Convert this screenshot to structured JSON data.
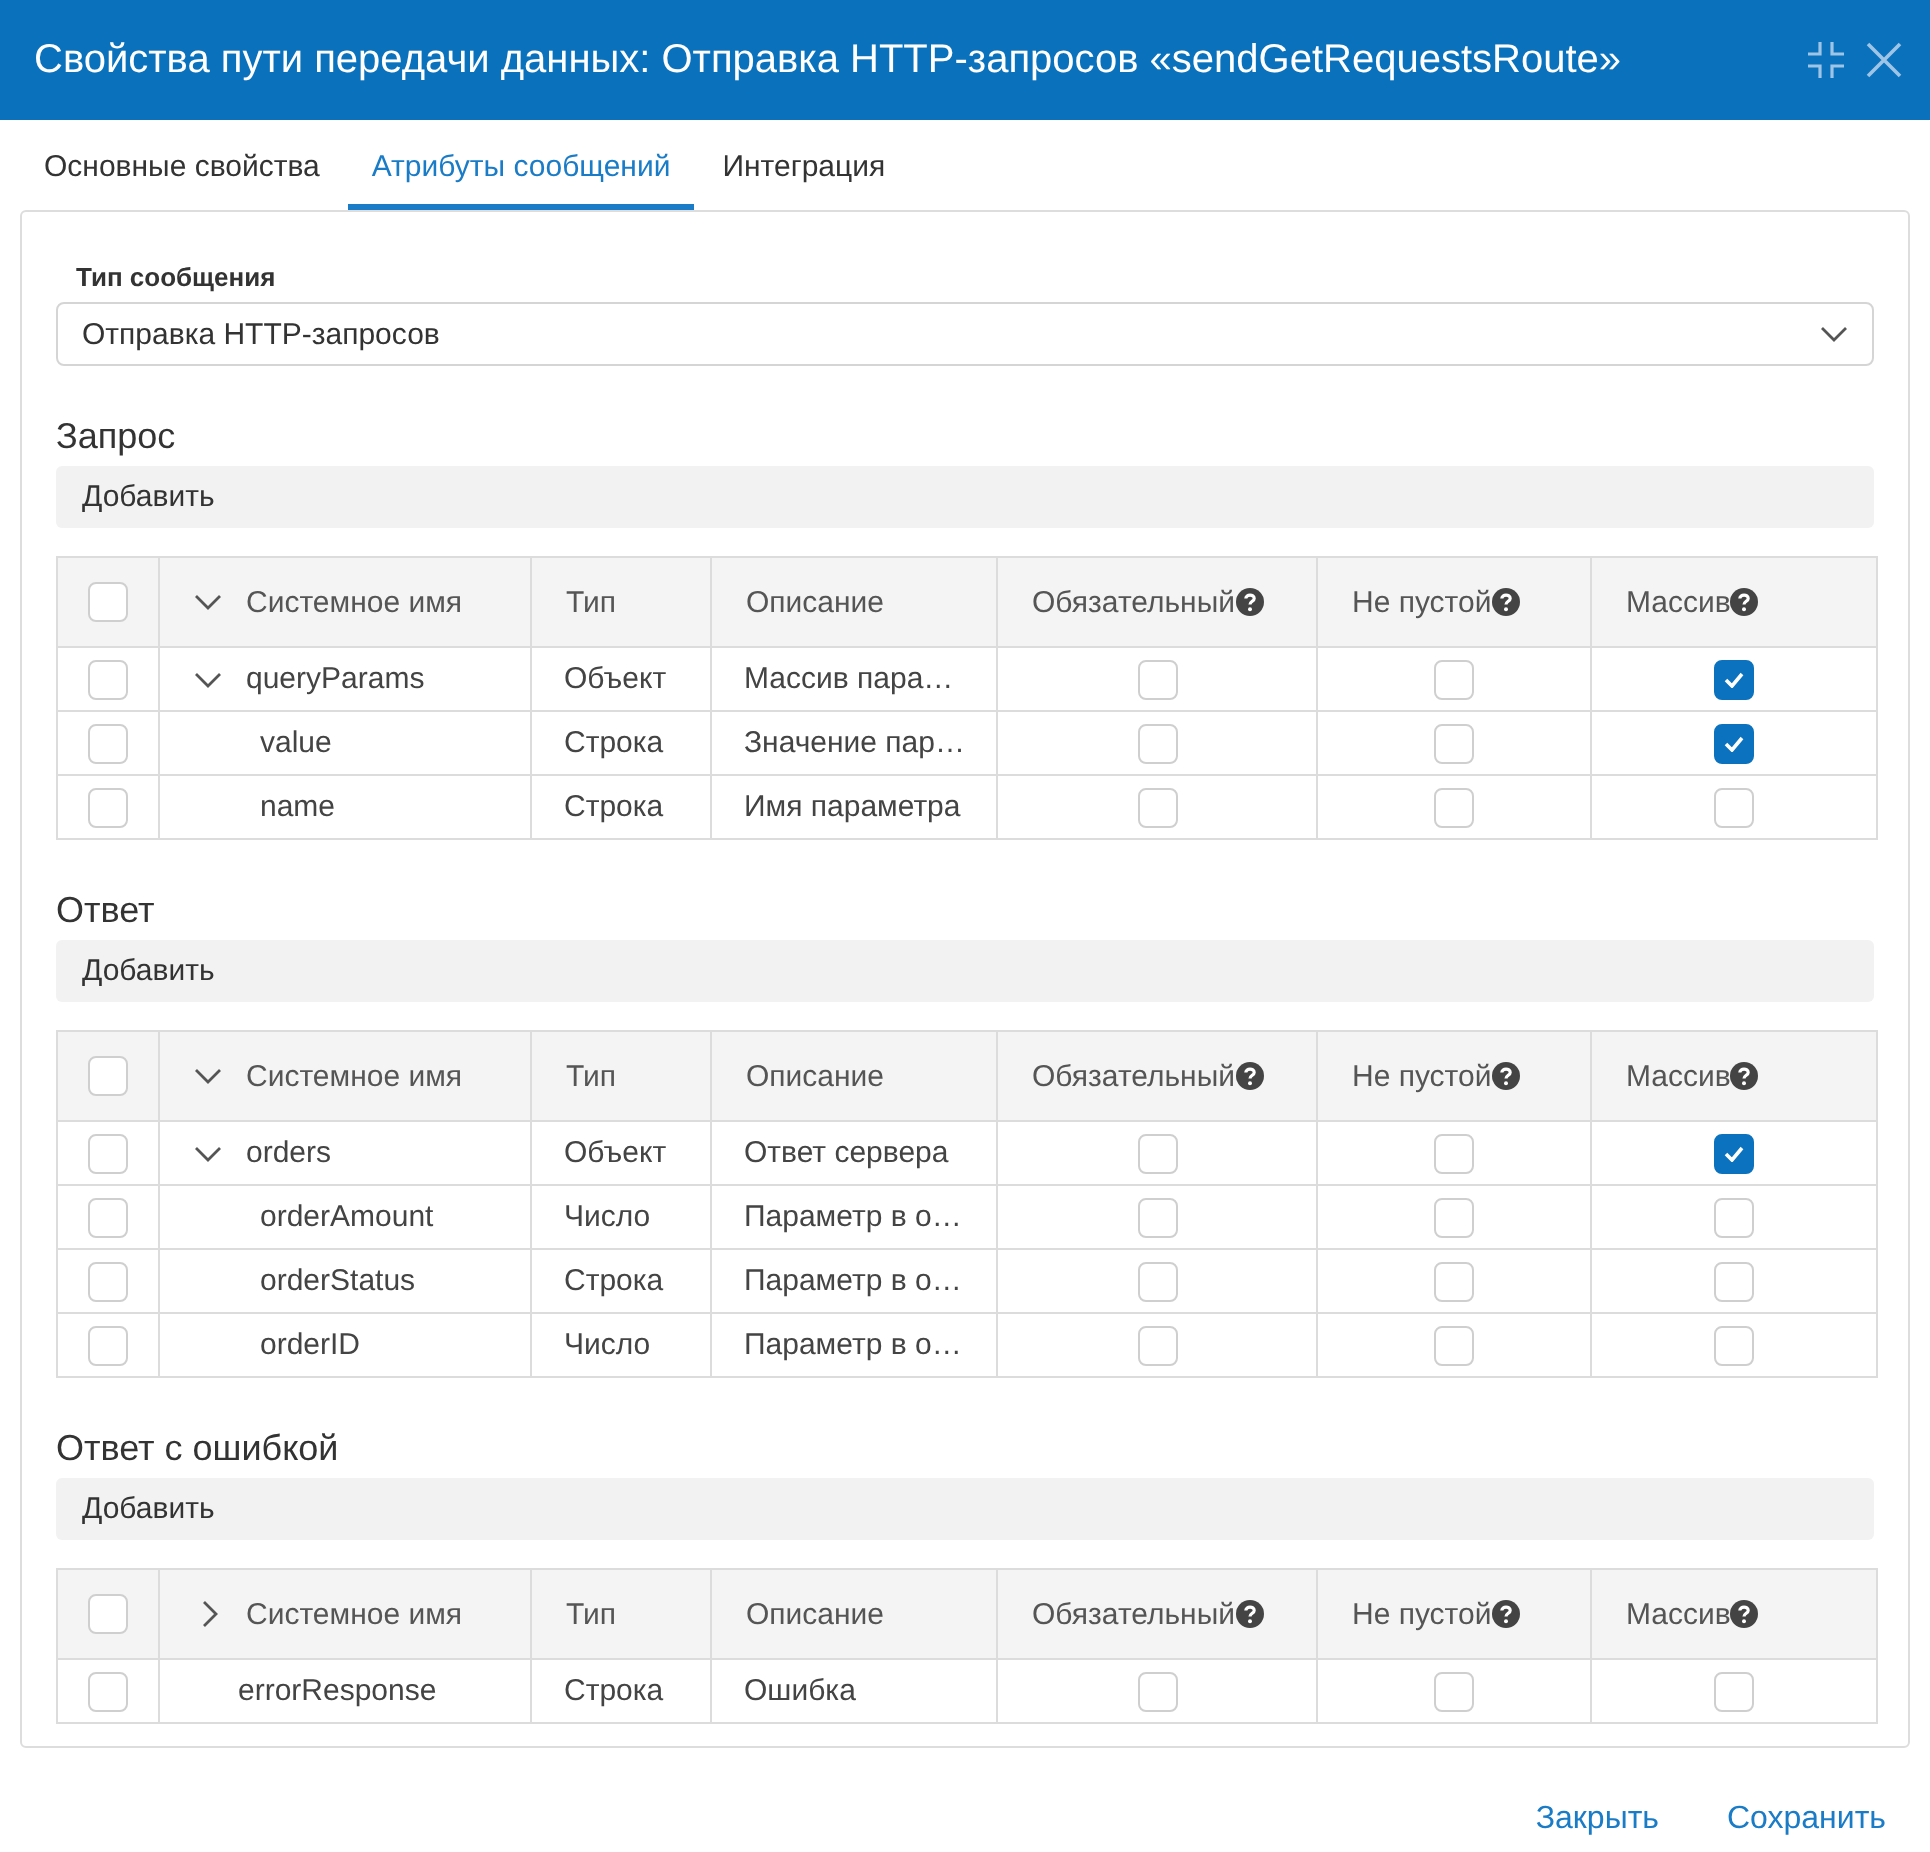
{
  "window": {
    "title": "Свойства пути передачи данных: Отправка HTTP-запросов «sendGetRequestsRoute»"
  },
  "tabs": [
    {
      "label": "Основные свойства",
      "selected": false
    },
    {
      "label": "Атрибуты сообщений",
      "selected": true
    },
    {
      "label": "Интеграция",
      "selected": false
    }
  ],
  "message_type": {
    "label": "Тип сообщения",
    "value": "Отправка HTTP-запросов"
  },
  "sections": [
    {
      "title": "Запрос",
      "add_button": "Добавить",
      "all_checked": false,
      "columns": [
        {
          "label": "Системное имя",
          "kind": "tree",
          "expanded": true
        },
        {
          "label": "Тип",
          "kind": "text"
        },
        {
          "label": "Описание",
          "kind": "text"
        },
        {
          "label": "Обязательный",
          "kind": "flag"
        },
        {
          "label": "Не пустой",
          "kind": "flag"
        },
        {
          "label": "Массив",
          "kind": "flag"
        }
      ],
      "rows": [
        {
          "checked": false,
          "cells": [
            "queryParams",
            "Объект",
            "Массив пара…"
          ],
          "flags": [
            false,
            false,
            true
          ],
          "expanded": true,
          "children": [
            {
              "checked": false,
              "cells": [
                "value",
                "Строка",
                "Значение пар…"
              ],
              "flags": [
                false,
                false,
                true
              ]
            },
            {
              "checked": false,
              "cells": [
                "name",
                "Строка",
                "Имя параметра"
              ],
              "flags": [
                false,
                false,
                false
              ]
            }
          ]
        }
      ]
    },
    {
      "title": "Ответ",
      "add_button": "Добавить",
      "all_checked": false,
      "columns": [
        {
          "label": "Системное имя",
          "kind": "tree",
          "expanded": true
        },
        {
          "label": "Тип",
          "kind": "text"
        },
        {
          "label": "Описание",
          "kind": "text"
        },
        {
          "label": "Обязательный",
          "kind": "flag"
        },
        {
          "label": "Не пустой",
          "kind": "flag"
        },
        {
          "label": "Массив",
          "kind": "flag"
        }
      ],
      "rows": [
        {
          "checked": false,
          "cells": [
            "orders",
            "Объект",
            "Ответ сервера"
          ],
          "flags": [
            false,
            false,
            true
          ],
          "expanded": true,
          "children": [
            {
              "checked": false,
              "cells": [
                "orderAmount",
                "Число",
                "Параметр в о…"
              ],
              "flags": [
                false,
                false,
                false
              ]
            },
            {
              "checked": false,
              "cells": [
                "orderStatus",
                "Строка",
                "Параметр в о…"
              ],
              "flags": [
                false,
                false,
                false
              ]
            },
            {
              "checked": false,
              "cells": [
                "orderID",
                "Число",
                "Параметр в о…"
              ],
              "flags": [
                false,
                false,
                false
              ]
            }
          ]
        }
      ]
    },
    {
      "title": "Ответ с ошибкой",
      "add_button": "Добавить",
      "all_checked": false,
      "columns": [
        {
          "label": "Системное имя",
          "kind": "tree",
          "expanded": false
        },
        {
          "label": "Тип",
          "kind": "text"
        },
        {
          "label": "Описание",
          "kind": "text"
        },
        {
          "label": "Обязательный",
          "kind": "flag"
        },
        {
          "label": "Не пустой",
          "kind": "flag"
        },
        {
          "label": "Массив",
          "kind": "flag"
        }
      ],
      "rows": [
        {
          "checked": false,
          "cells": [
            "errorResponse",
            "Строка",
            "Ошибка"
          ],
          "flags": [
            false,
            false,
            false
          ]
        }
      ]
    }
  ],
  "buttons": [
    {
      "label": "Закрыть"
    },
    {
      "label": "Сохранить"
    }
  ]
}
